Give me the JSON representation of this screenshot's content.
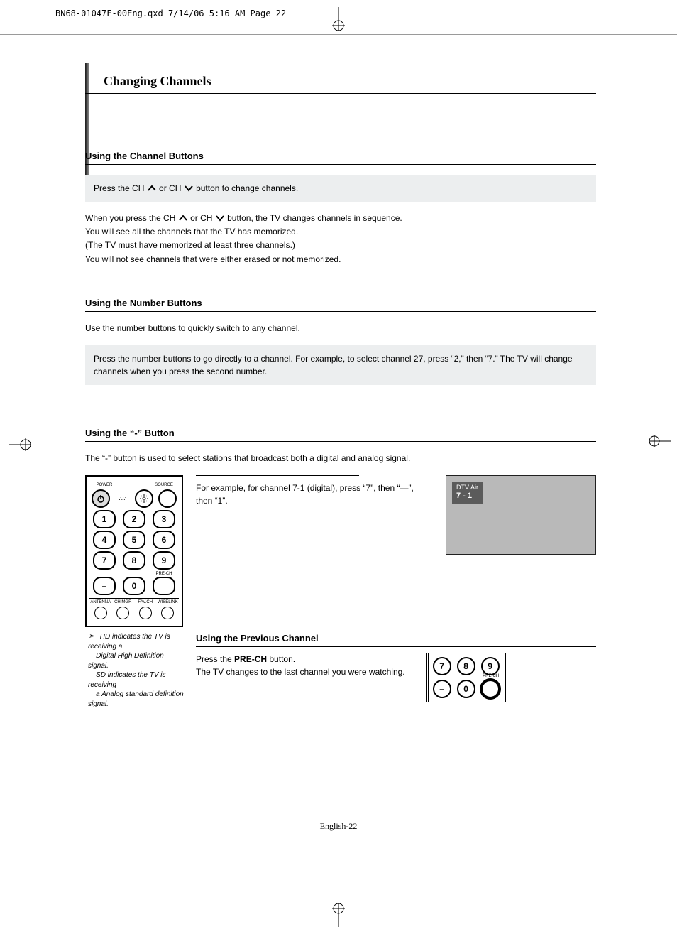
{
  "header": "BN68-01047F-00Eng.qxd  7/14/06  5:16 AM  Page 22",
  "title": "Changing Channels",
  "s1": {
    "heading": "Using the Channel Buttons",
    "box_pre": "Press the CH ",
    "box_mid": " or CH ",
    "box_post": " button to change channels.",
    "p1_pre": "When you press the CH ",
    "p1_mid": " or CH ",
    "p1_post": " button, the TV changes channels in sequence.",
    "p2": "You will see all the channels that the TV has memorized.",
    "p3": "(The TV must have memorized at least three channels.)",
    "p4": "You will not see channels that were either erased or not memorized."
  },
  "s2": {
    "heading": "Using the Number Buttons",
    "intro": "Use the number buttons to quickly switch to any channel.",
    "box": "Press the number buttons to go directly to a channel. For example, to select channel 27, press “2,” then “7.” The TV will change channels when you press the second number."
  },
  "s3": {
    "heading": "Using the “-” Button",
    "intro": "The “-” button is used to select stations that broadcast both a digital and analog signal.",
    "example": "For example, for channel 7-1 (digital), press “7”, then “—”, then “1”.",
    "tv_label1": "DTV Air",
    "tv_label2": "7 - 1"
  },
  "hd_note": {
    "l1": "HD indicates the TV is receiving a",
    "l2": "Digital High Definition signal.",
    "l3": "SD indicates the TV is receiving",
    "l4": "a Analog standard definition signal."
  },
  "s4": {
    "heading": "Using the Previous Channel",
    "p_pre": "Press the ",
    "p_bold": "PRE-CH",
    "p_post": " button.",
    "p2": "The TV changes to the last channel you were watching."
  },
  "remote": {
    "power": "POWER",
    "source": "SOURCE",
    "prech": "PRE-CH",
    "antenna": "ANTENNA",
    "chmgr": "CH MGR",
    "favch": "FAV.CH",
    "wiselink": "WISELINK",
    "n1": "1",
    "n2": "2",
    "n3": "3",
    "n4": "4",
    "n5": "5",
    "n6": "6",
    "n7": "7",
    "n8": "8",
    "n9": "9",
    "n0": "0",
    "dash": "–"
  },
  "footer": "English-22"
}
